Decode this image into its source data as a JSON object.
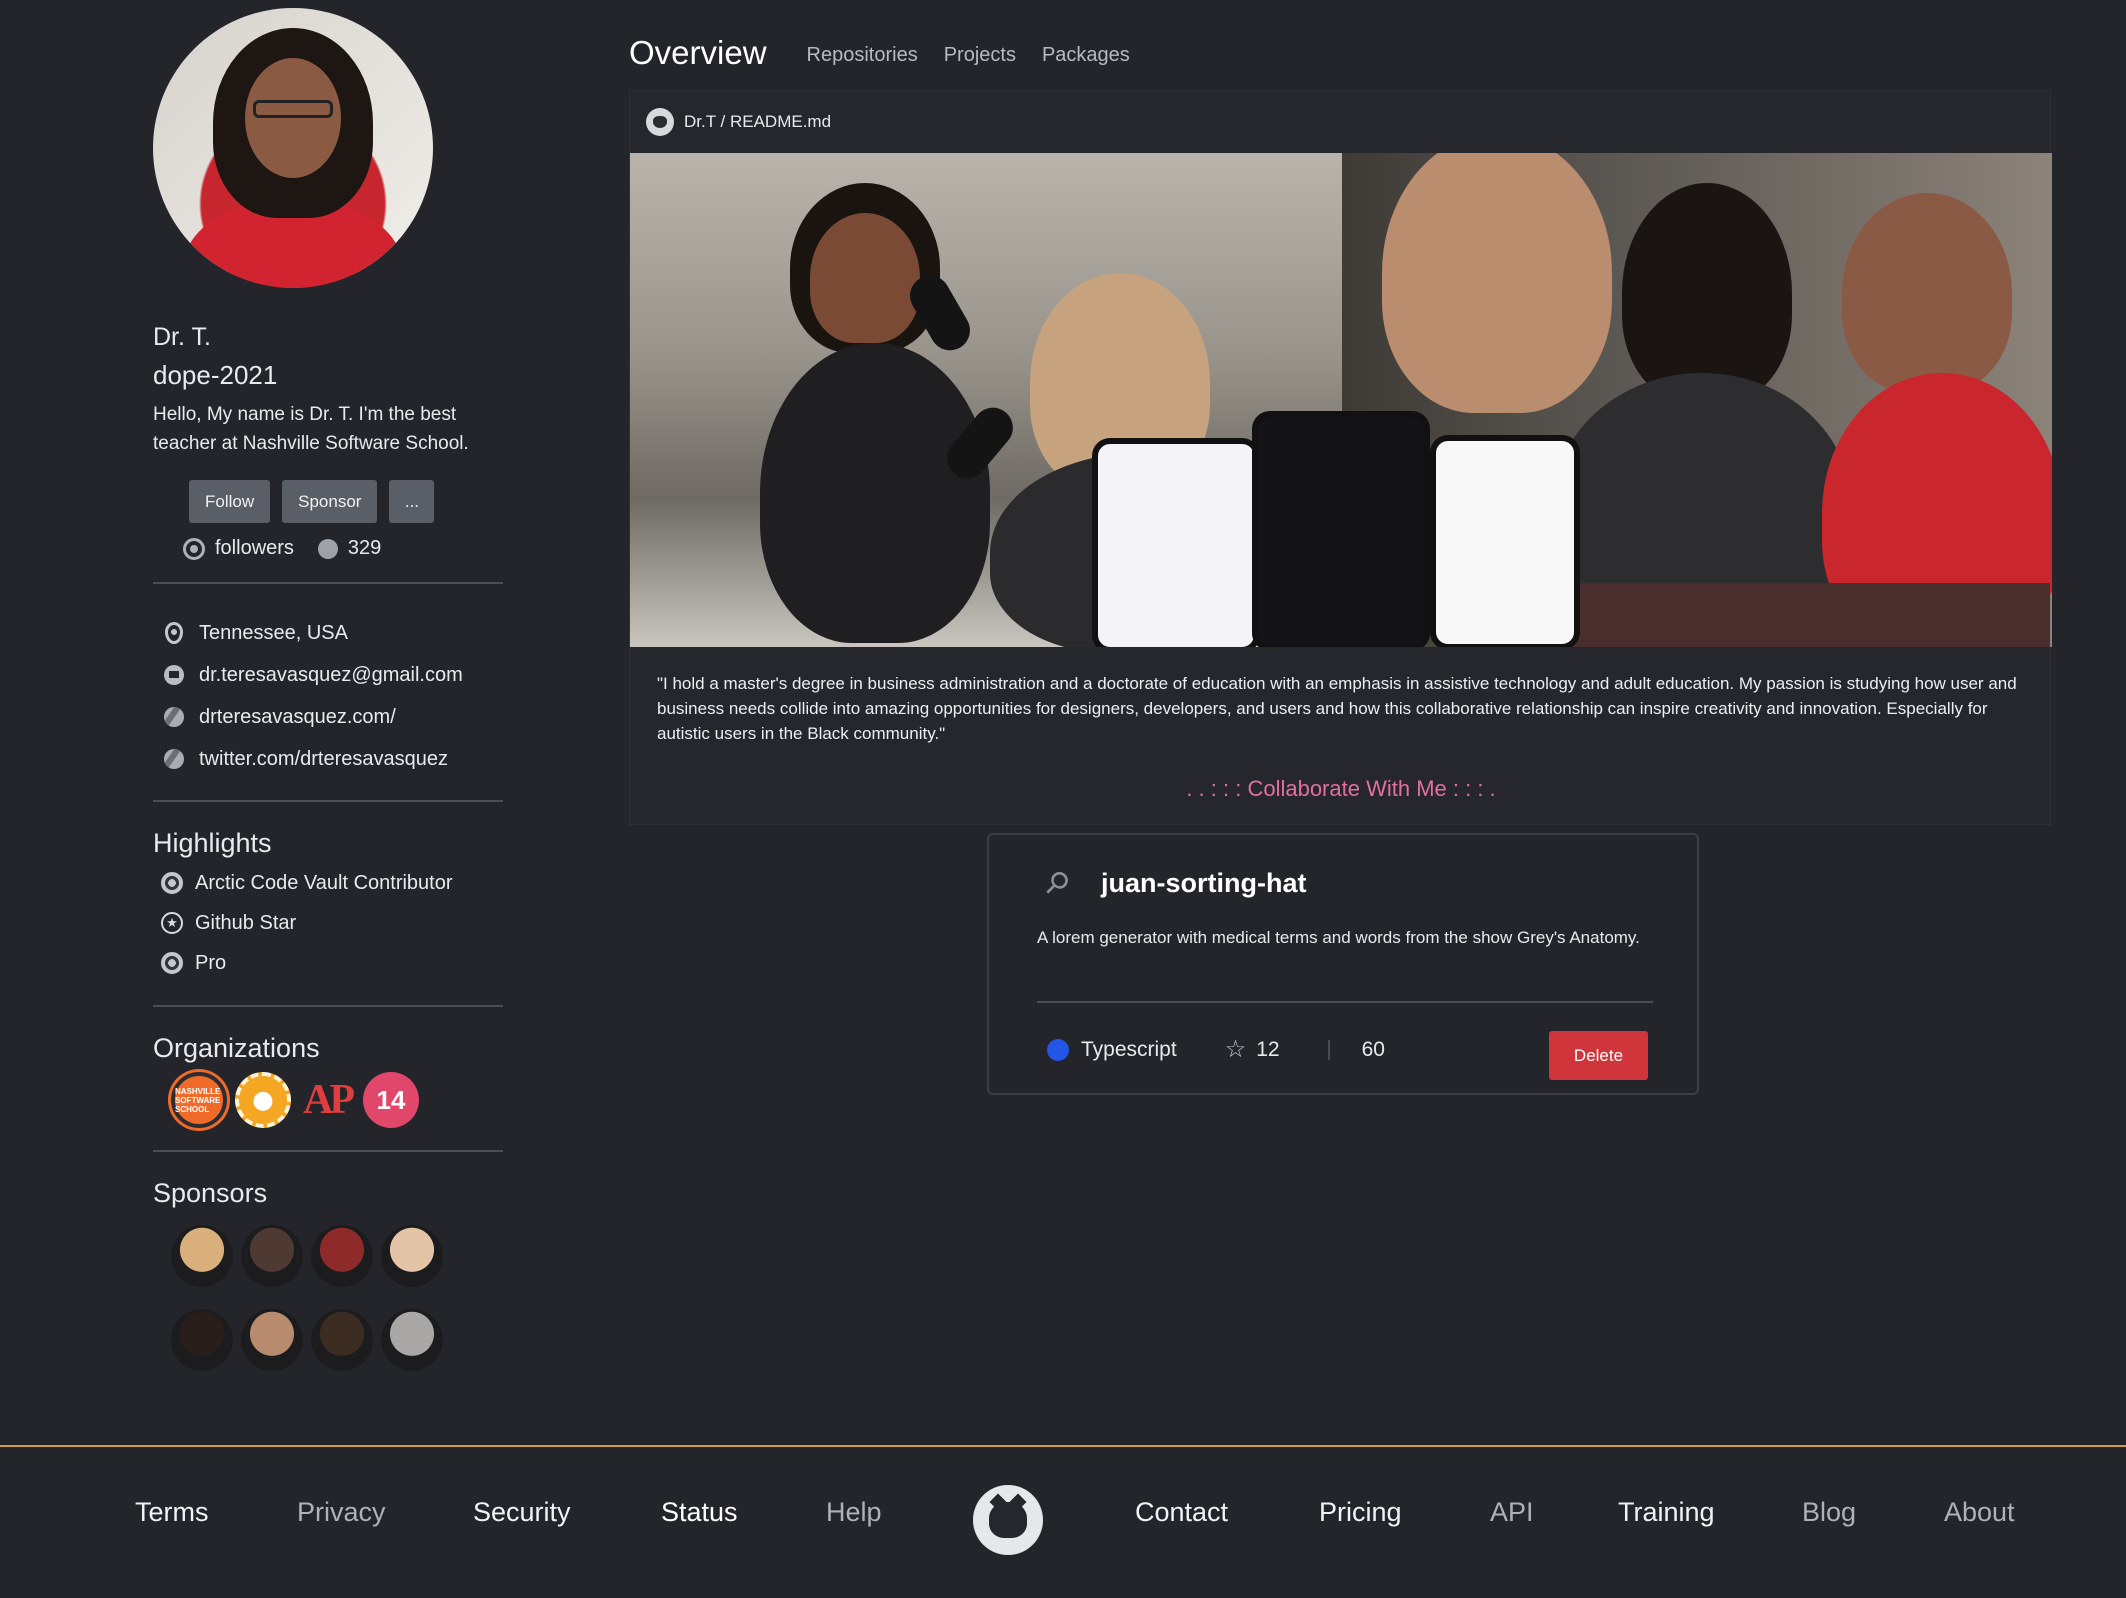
{
  "profile": {
    "name": "Dr. T.",
    "login": "dope-2021",
    "bio": "Hello, My name is Dr. T. I'm the best teacher at Nashville Software School.",
    "follow_label": "Follow",
    "sponsor_label": "Sponsor",
    "more_label": "...",
    "followers_label": "followers",
    "following_count": "329",
    "location": "Tennessee, USA",
    "email": "dr.teresavasquez@gmail.com",
    "website": "drteresavasquez.com/",
    "twitter": "twitter.com/drteresavasquez"
  },
  "highlights": {
    "title": "Highlights",
    "items": [
      "Arctic Code Vault Contributor",
      "Github Star",
      "Pro"
    ]
  },
  "organizations": {
    "title": "Organizations",
    "items": [
      {
        "name": "nashville-software-school",
        "text": "NASHVILLE SOFTWARE SCHOOL",
        "color": "#f06a2a"
      },
      {
        "name": "gold-badge",
        "text": "",
        "color": "#f5a623"
      },
      {
        "name": "ap",
        "text": "AP",
        "color": "#e03e3e"
      },
      {
        "name": "fourteen",
        "text": "14",
        "color": "#e0476b"
      }
    ]
  },
  "sponsors": {
    "title": "Sponsors",
    "avatar_colors": [
      "#d9b07c",
      "#4e3a33",
      "#8e2a2a",
      "#e4c4a6",
      "#2a1e1a",
      "#b88a6e",
      "#3d2c22",
      "#a9a8a6"
    ]
  },
  "tabs": {
    "overview": "Overview",
    "repositories": "Repositories",
    "projects": "Projects",
    "packages": "Packages"
  },
  "readme": {
    "path": "Dr.T / README.md",
    "quote": "\"I hold a master's degree in business administration and a doctorate of education with an emphasis in assistive technology and adult education. My passion is studying how user and business needs collide into amazing opportunities for designers, developers, and users and how this collaborative relationship can inspire creativity and innovation. Especially for autistic users in the Black community.\"",
    "collab": ". . : : : Collaborate With Me : : : ."
  },
  "pinned": {
    "repo_name": "juan-sorting-hat",
    "description": "A lorem generator with medical terms and words from the show Grey's Anatomy.",
    "language": "Typescript",
    "language_color": "#2355e6",
    "stars": "12",
    "forks": "60",
    "delete_label": "Delete"
  },
  "footer": {
    "terms": "Terms",
    "privacy": "Privacy",
    "security": "Security",
    "status": "Status",
    "help": "Help",
    "contact": "Contact",
    "pricing": "Pricing",
    "api": "API",
    "training": "Training",
    "blog": "Blog",
    "about": "About"
  }
}
